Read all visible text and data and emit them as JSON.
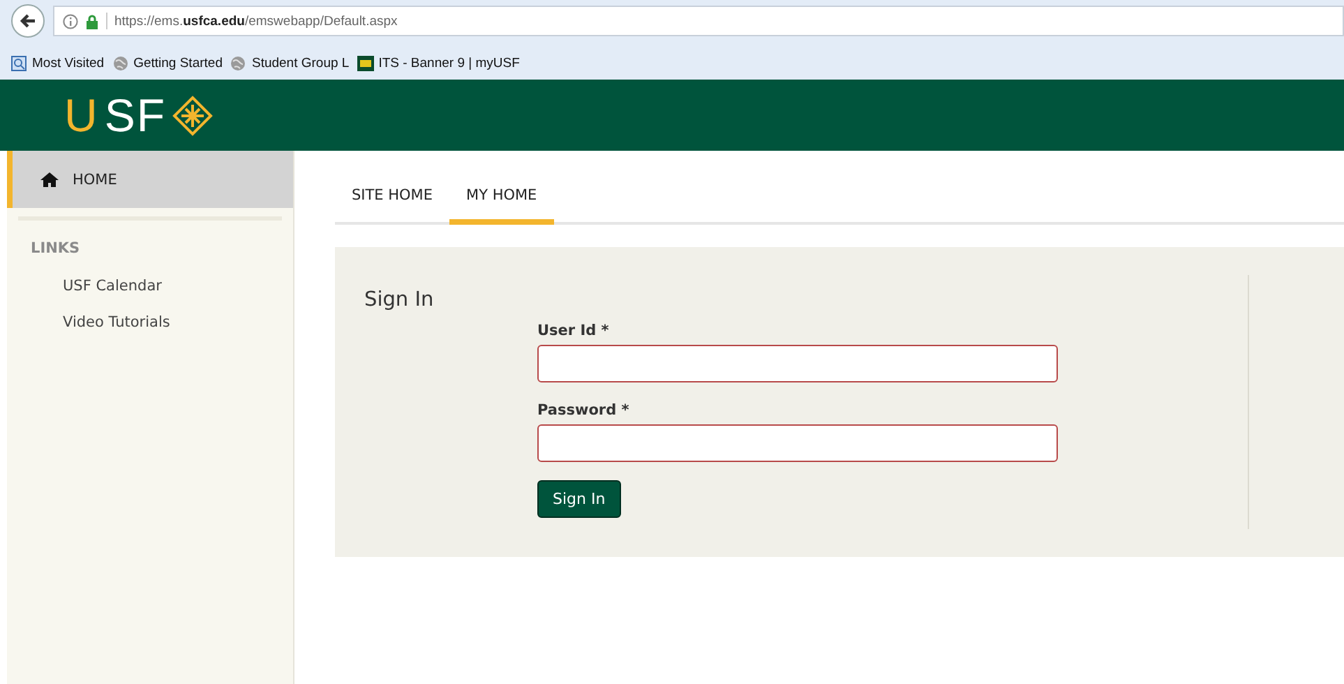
{
  "browser": {
    "url": "https://ems.**usfca.edu**/emswebapp/Default.aspx",
    "bookmarks": [
      {
        "kind": "search",
        "label": "Most Visited"
      },
      {
        "kind": "globe",
        "label": "Getting Started"
      },
      {
        "kind": "globe",
        "label": "Student Group L"
      },
      {
        "kind": "usf",
        "label": "ITS - Banner 9 | myUSF"
      }
    ]
  },
  "header": {
    "logo_accent": "U",
    "logo_rest": "SF"
  },
  "sidebar": {
    "home": {
      "label": "HOME",
      "selected": true
    },
    "section": "LINKS",
    "items": [
      {
        "label": "USF Calendar",
        "selected": false
      },
      {
        "label": "Video Tutorials",
        "selected": false
      }
    ]
  },
  "tabs": [
    {
      "label": "SITE HOME",
      "selected": false
    },
    {
      "label": "MY HOME",
      "selected": true
    }
  ],
  "sign_in": {
    "title": "Sign In",
    "fields": [
      {
        "label": "User Id *",
        "invalid": true
      },
      {
        "label": "Password *",
        "invalid": true
      }
    ],
    "button": "Sign In"
  }
}
